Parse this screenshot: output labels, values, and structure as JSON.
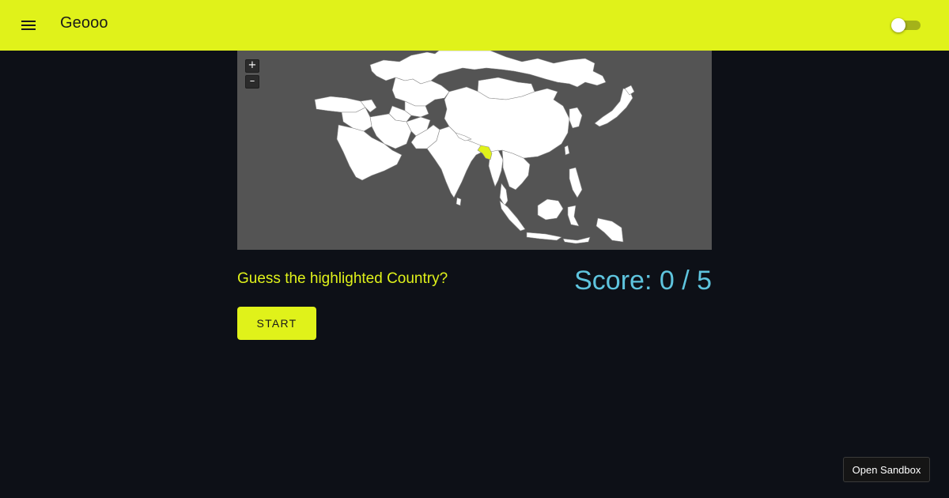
{
  "appbar": {
    "title": "Geooo",
    "menu_icon": "hamburger-icon",
    "toggle_state": "off"
  },
  "map": {
    "zoom_in_label": "+",
    "zoom_out_label": "–",
    "highlighted_country": "Bangladesh",
    "ocean_color": "#545454",
    "land_color": "#ffffff",
    "highlight_color": "#e0f21a"
  },
  "game": {
    "question": "Guess the highlighted Country?",
    "score_text": "Score: 0 / 5",
    "score": 0,
    "total": 5,
    "start_label": "START"
  },
  "footer": {
    "sandbox_label": "Open Sandbox"
  },
  "colors": {
    "accent": "#e0f21a",
    "background": "#0d1017",
    "score": "#5ec4de"
  }
}
